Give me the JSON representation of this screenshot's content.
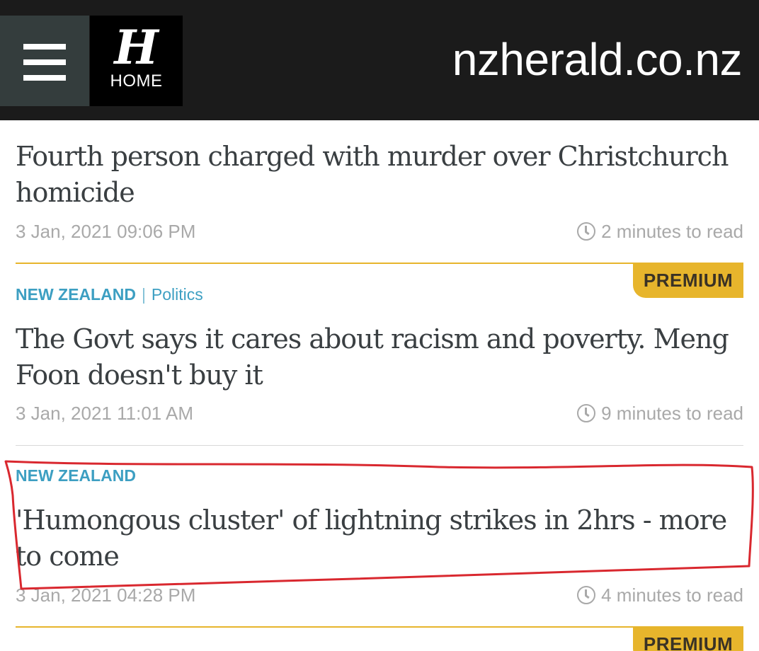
{
  "header": {
    "logo_glyph": "H",
    "home_label": "HOME",
    "site_name": "nzherald.co.nz"
  },
  "articles": [
    {
      "headline": "Fourth person charged with murder over Christchurch homicide",
      "date": "3 Jan, 2021 09:06 PM",
      "read_time": "2 minutes to read"
    },
    {
      "premium_label": "PREMIUM",
      "section": "NEW ZEALAND",
      "subsection": "Politics",
      "headline": "The Govt says it cares about racism and poverty. Meng Foon doesn't buy it",
      "date": "3 Jan, 2021 11:01 AM",
      "read_time": "9 minutes to read"
    },
    {
      "section": "NEW ZEALAND",
      "headline": "'Humongous cluster' of lightning strikes in 2hrs - more to come",
      "date": "3 Jan, 2021 04:28 PM",
      "read_time": "4 minutes to read"
    }
  ],
  "next_premium_label": "PREMIUM",
  "icons": {
    "menu": "hamburger-menu-icon",
    "clock": "clock-icon"
  },
  "colors": {
    "header_bg": "#1b1b1b",
    "menu_bg": "#343d3d",
    "section_blue": "#3d9fc2",
    "premium_gold": "#e7b52c",
    "annotation_red": "#d9282f"
  }
}
